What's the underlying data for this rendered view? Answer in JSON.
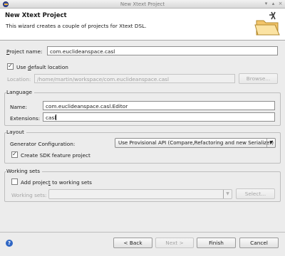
{
  "window": {
    "title": "New Xtext Project"
  },
  "header": {
    "title": "New Xtext Project",
    "description": "This wizard creates a couple of projects for Xtext DSL."
  },
  "project": {
    "name_label_prefix": "",
    "name_label_mnemonic": "P",
    "name_label_rest": "roject name:",
    "name_value": "com.euclideanspace.casl",
    "use_default_prefix": "Use ",
    "use_default_mnemonic": "d",
    "use_default_rest": "efault location",
    "use_default_checked": true,
    "location_label": "Location:",
    "location_value": "/home/martin/workspace/com.euclideanspace.casl",
    "browse_label": "Browse..."
  },
  "language": {
    "group_label": "Language",
    "name_label": "Name:",
    "name_value": "com.euclideanspace.casl.Editor",
    "extensions_label": "Extensions:",
    "extensions_value": "casl"
  },
  "layout": {
    "group_label": "Layout",
    "generator_label": "Generator Configuration:",
    "generator_value": "Use Provisional API (Compare,Refactoring and new Serializer)",
    "create_sdk_label": "Create SDK feature project",
    "create_sdk_checked": true
  },
  "working_sets": {
    "group_label": "Working sets",
    "add_label_prefix": "Add projec",
    "add_label_mnemonic": "t",
    "add_label_rest": " to working sets",
    "add_checked": false,
    "working_sets_label": "Working sets:",
    "working_sets_value": "",
    "select_label": "Select..."
  },
  "footer": {
    "help_glyph": "?",
    "back_label": "< Back",
    "next_label": "Next >",
    "finish_label": "Finish",
    "cancel_label": "Cancel"
  }
}
